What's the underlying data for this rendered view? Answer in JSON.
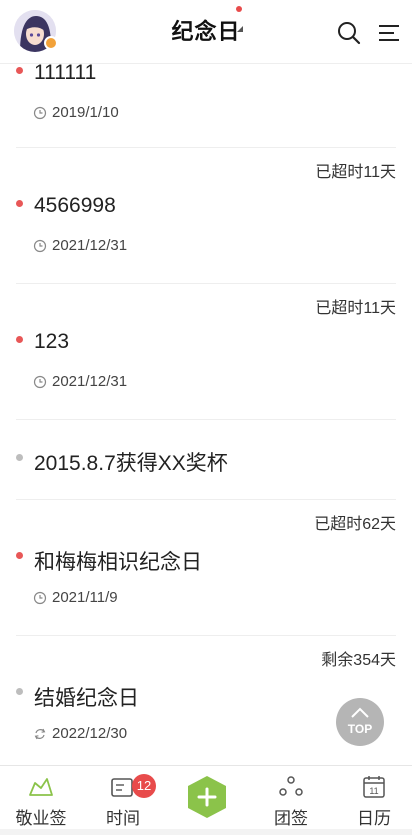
{
  "header": {
    "title": "纪念日"
  },
  "items": [
    {
      "status": "",
      "name": "111111",
      "date": "2019/1/10",
      "dot": "red",
      "icon": "clock-icon"
    },
    {
      "status": "已超时11天",
      "name": "4566998",
      "date": "2021/12/31",
      "dot": "red",
      "icon": "clock-icon"
    },
    {
      "status": "已超时11天",
      "name": "123",
      "date": "2021/12/31",
      "dot": "red",
      "icon": "clock-icon"
    },
    {
      "status": "",
      "name": "2015.8.7获得XX奖杯",
      "date": "",
      "dot": "grey",
      "icon": ""
    },
    {
      "status": "已超时62天",
      "name": "和梅梅相识纪念日",
      "date": "2021/11/9",
      "dot": "red",
      "icon": "clock-icon"
    },
    {
      "status": "剩余354天",
      "name": "结婚纪念日",
      "date": "2022/12/30",
      "dot": "grey",
      "icon": "repeat-icon"
    }
  ],
  "top_button": {
    "label": "TOP"
  },
  "tabs": {
    "jingye": "敬业签",
    "time": "时间",
    "time_badge": "12",
    "team": "团签",
    "calendar": "日历",
    "calendar_day": "11"
  },
  "colors": {
    "accent_green": "#8bc34a",
    "dot_red": "#e85757",
    "dot_grey": "#bdbdbd",
    "badge_red": "#e84b4b"
  }
}
